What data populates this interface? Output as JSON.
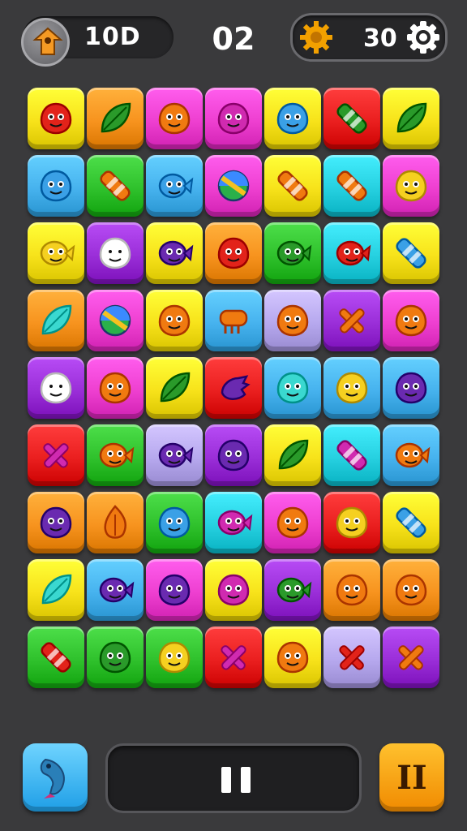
{
  "hud": {
    "score": "10D",
    "moves": "02",
    "coins": "30",
    "avatar_icon": "home-arrow-icon",
    "coin_icon": "gear-coin-icon",
    "settings_icon": "gear-icon"
  },
  "colors": {
    "background": "#3a3a3c",
    "yellow": "#f7e21a",
    "orange": "#f7931e",
    "magenta": "#ee3fd0",
    "blue": "#46b2ee",
    "green": "#2fc12c",
    "red": "#ea1f1f",
    "cyan": "#26d0e0",
    "purple": "#9a2ed8",
    "lavender": "#b6a8ee"
  },
  "board": {
    "rows": [
      [
        {
          "color": "yellow",
          "piece": "red-blob"
        },
        {
          "color": "orange",
          "piece": "green-leaf"
        },
        {
          "color": "magenta",
          "piece": "orange-face"
        },
        {
          "color": "magenta",
          "piece": "magenta-blob"
        },
        {
          "color": "yellow",
          "piece": "blue-blob"
        },
        {
          "color": "red",
          "piece": "green-candy"
        },
        {
          "color": "yellow",
          "piece": "green-leaf"
        }
      ],
      [
        {
          "color": "blue",
          "piece": "blue-blob"
        },
        {
          "color": "green",
          "piece": "orange-carrot"
        },
        {
          "color": "blue",
          "piece": "blue-fish"
        },
        {
          "color": "magenta",
          "piece": "rainbow-ball"
        },
        {
          "color": "yellow",
          "piece": "orange-pencil"
        },
        {
          "color": "cyan",
          "piece": "orange-candy"
        },
        {
          "color": "magenta",
          "piece": "yellow-face"
        }
      ],
      [
        {
          "color": "yellow",
          "piece": "yellow-fish"
        },
        {
          "color": "purple",
          "piece": "white-face"
        },
        {
          "color": "yellow",
          "piece": "purple-fish"
        },
        {
          "color": "orange",
          "piece": "red-blob"
        },
        {
          "color": "green",
          "piece": "green-fish"
        },
        {
          "color": "cyan",
          "piece": "red-fish"
        },
        {
          "color": "yellow",
          "piece": "blue-candy"
        }
      ],
      [
        {
          "color": "orange",
          "piece": "cyan-leaf"
        },
        {
          "color": "magenta",
          "piece": "rainbow-ball"
        },
        {
          "color": "yellow",
          "piece": "orange-blob"
        },
        {
          "color": "blue",
          "piece": "orange-comb"
        },
        {
          "color": "lavender",
          "piece": "orange-face"
        },
        {
          "color": "purple",
          "piece": "orange-cross"
        },
        {
          "color": "magenta",
          "piece": "orange-face"
        }
      ],
      [
        {
          "color": "purple",
          "piece": "white-face"
        },
        {
          "color": "magenta",
          "piece": "orange-face"
        },
        {
          "color": "yellow",
          "piece": "green-leaf"
        },
        {
          "color": "red",
          "piece": "purple-hand"
        },
        {
          "color": "blue",
          "piece": "cyan-blob"
        },
        {
          "color": "blue",
          "piece": "yellow-face"
        },
        {
          "color": "blue",
          "piece": "purple-blob"
        }
      ],
      [
        {
          "color": "red",
          "piece": "magenta-cross"
        },
        {
          "color": "green",
          "piece": "orange-fish"
        },
        {
          "color": "lavender",
          "piece": "purple-fish"
        },
        {
          "color": "purple",
          "piece": "purple-blob"
        },
        {
          "color": "yellow",
          "piece": "green-leaf"
        },
        {
          "color": "cyan",
          "piece": "magenta-candy"
        },
        {
          "color": "blue",
          "piece": "orange-fish"
        }
      ],
      [
        {
          "color": "orange",
          "piece": "purple-face"
        },
        {
          "color": "orange",
          "piece": "orange-flame"
        },
        {
          "color": "green",
          "piece": "blue-blob"
        },
        {
          "color": "cyan",
          "piece": "magenta-fish"
        },
        {
          "color": "magenta",
          "piece": "orange-face"
        },
        {
          "color": "red",
          "piece": "yellow-face"
        },
        {
          "color": "yellow",
          "piece": "blue-candy"
        }
      ],
      [
        {
          "color": "yellow",
          "piece": "cyan-leaf"
        },
        {
          "color": "blue",
          "piece": "purple-fish"
        },
        {
          "color": "magenta",
          "piece": "purple-face"
        },
        {
          "color": "yellow",
          "piece": "magenta-blob"
        },
        {
          "color": "purple",
          "piece": "green-fish"
        },
        {
          "color": "orange",
          "piece": "orange-face"
        },
        {
          "color": "orange",
          "piece": "orange-blob"
        }
      ],
      [
        {
          "color": "green",
          "piece": "red-candy"
        },
        {
          "color": "green",
          "piece": "green-face"
        },
        {
          "color": "green",
          "piece": "yellow-face"
        },
        {
          "color": "red",
          "piece": "magenta-cross"
        },
        {
          "color": "yellow",
          "piece": "orange-face"
        },
        {
          "color": "lavender",
          "piece": "red-cross"
        },
        {
          "color": "purple",
          "piece": "orange-cross"
        }
      ]
    ]
  },
  "controls": {
    "hint_icon": "fish-hint-icon",
    "pause_icon": "pause-icon",
    "right_button_label": "II"
  }
}
